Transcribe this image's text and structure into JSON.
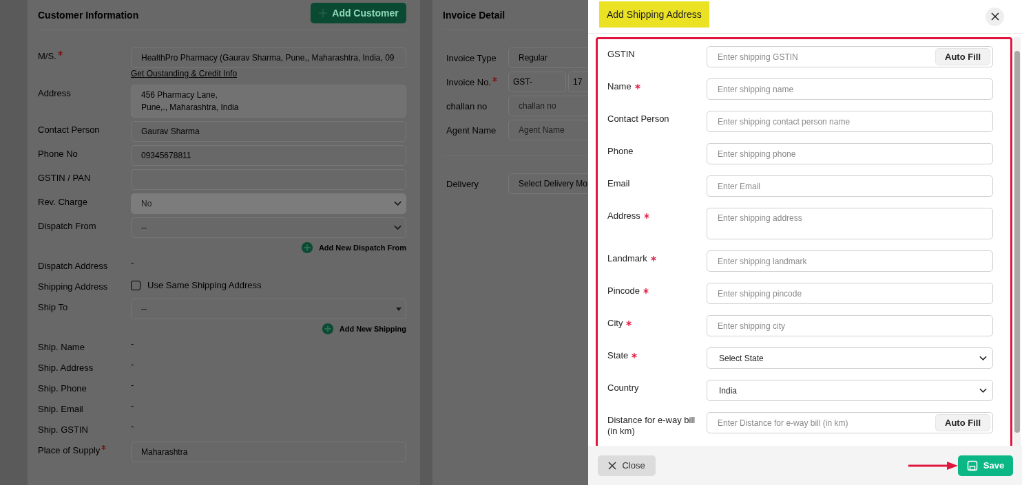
{
  "customer": {
    "title": "Customer Information",
    "add_button": "Add Customer",
    "fields": [
      {
        "kind": "input",
        "label": "M/S.",
        "required": true,
        "value": "HealthPro Pharmacy (Gaurav Sharma, Pune,, Maharashtra, India, 09"
      },
      {
        "kind": "link",
        "text": "Get Oustanding & Credit Info"
      },
      {
        "kind": "textarea",
        "label": "Address",
        "required": false,
        "value": "456 Pharmacy Lane,\nPune,., Maharashtra, India"
      },
      {
        "kind": "input",
        "label": "Contact Person",
        "required": false,
        "value": "Gaurav Sharma"
      },
      {
        "kind": "input",
        "label": "Phone No",
        "required": false,
        "value": "09345678811"
      },
      {
        "kind": "input",
        "label": "GSTIN / PAN",
        "required": false
      },
      {
        "kind": "select",
        "label": "Rev. Charge",
        "required": false,
        "value": "No",
        "disabled": true
      },
      {
        "kind": "select",
        "label": "Dispatch From",
        "required": false,
        "value": "--",
        "disabled": false
      },
      {
        "kind": "add",
        "text": "Add New Dispatch From"
      },
      {
        "kind": "text",
        "label": "Dispatch Address",
        "value": "-"
      },
      {
        "kind": "checkbox",
        "label": "Shipping Address",
        "text": "Use Same Shipping Address",
        "checked": false
      },
      {
        "kind": "combo",
        "label": "Ship To",
        "required": false,
        "value": "--"
      },
      {
        "kind": "add",
        "text": "Add New Shipping"
      },
      {
        "kind": "text",
        "label": "Ship. Name",
        "value": "-"
      },
      {
        "kind": "text",
        "label": "Ship. Address",
        "value": "-"
      },
      {
        "kind": "text",
        "label": "Ship. Phone",
        "value": "-"
      },
      {
        "kind": "text",
        "label": "Ship. Email",
        "value": "-"
      },
      {
        "kind": "text",
        "label": "Ship. GSTIN",
        "value": "-"
      },
      {
        "kind": "input",
        "label": "Place of Supply",
        "required": true,
        "value": "Maharashtra"
      }
    ]
  },
  "invoice": {
    "title": "Invoice Detail",
    "groups": [
      [
        {
          "kind": "select",
          "label": "Invoice Type",
          "required": false,
          "value": "Regular"
        },
        {
          "kind": "split",
          "label": "Invoice No.",
          "required": true,
          "values": [
            "GST-",
            "17"
          ]
        },
        {
          "kind": "input",
          "label": "challan no",
          "required": false,
          "placeholder": "challan no"
        },
        {
          "kind": "input",
          "label": "Agent Name",
          "required": false,
          "placeholder": "Agent Name"
        }
      ],
      [
        {
          "kind": "select",
          "label": "Delivery",
          "required": false,
          "value": "Select Delivery Mo"
        }
      ]
    ]
  },
  "drawer": {
    "title": "Add Shipping Address",
    "fields": [
      {
        "kind": "input",
        "label": "GSTIN",
        "required": false,
        "placeholder": "Enter shipping GSTIN",
        "button": "Auto Fill"
      },
      {
        "kind": "input",
        "label": "Name",
        "required": true,
        "placeholder": "Enter shipping name"
      },
      {
        "kind": "input",
        "label": "Contact Person",
        "required": false,
        "placeholder": "Enter shipping contact person name"
      },
      {
        "kind": "input",
        "label": "Phone",
        "required": false,
        "placeholder": "Enter shipping phone"
      },
      {
        "kind": "input",
        "label": "Email",
        "required": false,
        "placeholder": "Enter Email"
      },
      {
        "kind": "textarea",
        "label": "Address",
        "required": true,
        "placeholder": "Enter shipping address"
      },
      {
        "kind": "input",
        "label": "Landmark",
        "required": true,
        "placeholder": "Enter shipping landmark"
      },
      {
        "kind": "input",
        "label": "Pincode",
        "required": true,
        "placeholder": "Enter shipping pincode"
      },
      {
        "kind": "input",
        "label": "City",
        "required": true,
        "placeholder": "Enter shipping city"
      },
      {
        "kind": "select",
        "label": "State",
        "required": true,
        "value": "Select State"
      },
      {
        "kind": "select",
        "label": "Country",
        "required": false,
        "value": "India"
      },
      {
        "kind": "input",
        "label": "Distance for e-way bill (in km)",
        "required": false,
        "placeholder": "Enter Distance for e-way bill (in km)",
        "button": "Auto Fill"
      }
    ],
    "close_button": "Close",
    "save_button": "Save"
  }
}
